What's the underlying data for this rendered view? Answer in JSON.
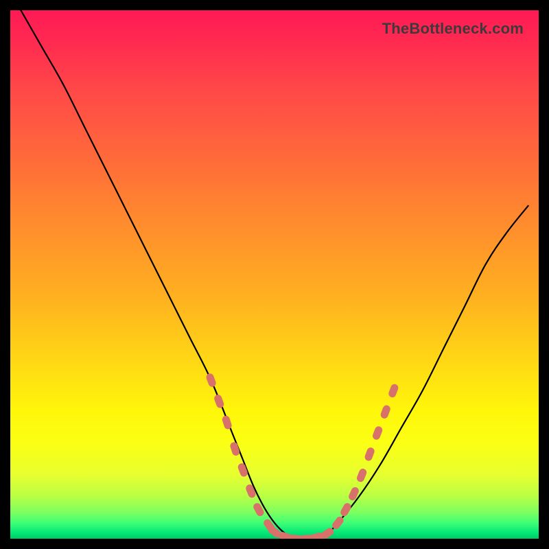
{
  "watermark": "TheBottleneck.com",
  "chart_data": {
    "type": "line",
    "title": "",
    "xlabel": "",
    "ylabel": "",
    "xlim": [
      0,
      100
    ],
    "ylim": [
      0,
      100
    ],
    "grid": false,
    "legend": false,
    "series": [
      {
        "name": "bottleneck-curve",
        "color": "#000000",
        "x": [
          2,
          6,
          10,
          14,
          18,
          22,
          26,
          30,
          34,
          38,
          42,
          44,
          46,
          48,
          50,
          52,
          54,
          56,
          58,
          60,
          62,
          66,
          70,
          74,
          78,
          82,
          86,
          90,
          94,
          98
        ],
        "y": [
          100,
          93,
          86,
          78,
          70,
          62,
          54,
          46,
          38,
          30,
          20,
          15,
          10,
          6,
          3,
          1,
          0,
          0,
          0,
          1,
          3,
          8,
          14,
          21,
          28,
          36,
          44,
          52,
          58,
          63
        ]
      }
    ],
    "markers": [
      {
        "name": "range-dots",
        "color": "#d9716b",
        "points": [
          {
            "x": 38,
            "y": 30
          },
          {
            "x": 39.5,
            "y": 26
          },
          {
            "x": 41,
            "y": 22
          },
          {
            "x": 42.5,
            "y": 17
          },
          {
            "x": 44,
            "y": 13
          },
          {
            "x": 45.5,
            "y": 9
          },
          {
            "x": 47,
            "y": 5.5
          },
          {
            "x": 49,
            "y": 2.5
          },
          {
            "x": 50,
            "y": 1.3
          },
          {
            "x": 52,
            "y": 0.4
          },
          {
            "x": 54,
            "y": 0
          },
          {
            "x": 56,
            "y": 0
          },
          {
            "x": 58,
            "y": 0.3
          },
          {
            "x": 60,
            "y": 1.0
          },
          {
            "x": 62,
            "y": 3
          },
          {
            "x": 63.5,
            "y": 5.5
          },
          {
            "x": 65,
            "y": 8.5
          },
          {
            "x": 66.5,
            "y": 12
          },
          {
            "x": 68,
            "y": 16
          },
          {
            "x": 69.5,
            "y": 20
          },
          {
            "x": 71,
            "y": 24
          },
          {
            "x": 72.5,
            "y": 28
          }
        ]
      }
    ],
    "background_gradient": {
      "top": "#ff1a55",
      "mid_upper": "#ff8b2e",
      "mid": "#fff70a",
      "bottom": "#00c864"
    }
  }
}
